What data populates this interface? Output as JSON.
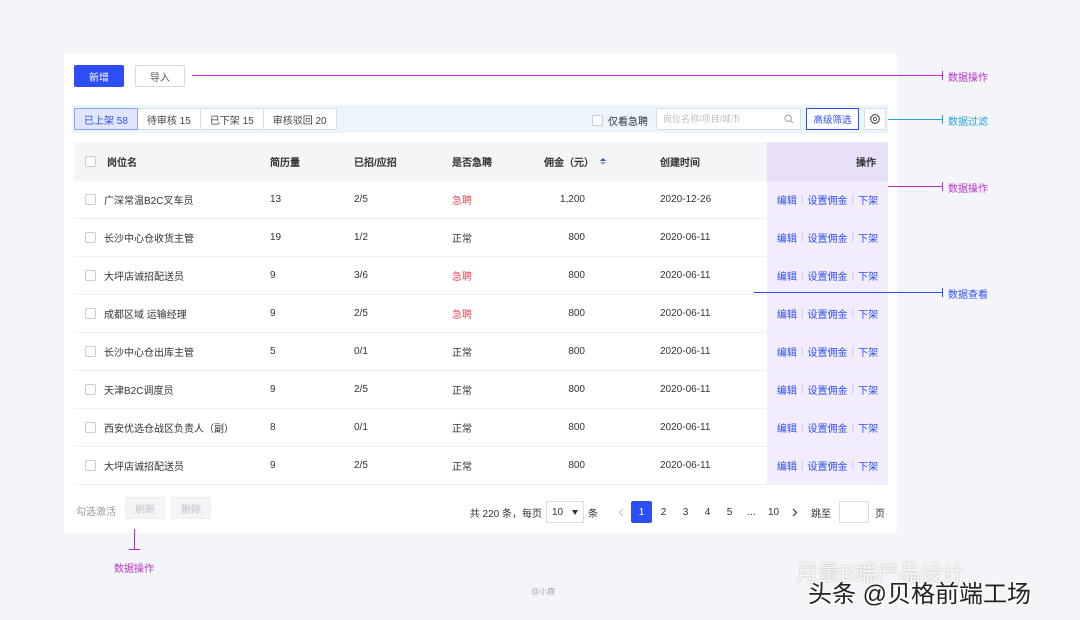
{
  "toolbar": {
    "add_label": "新增",
    "import_label": "导入"
  },
  "filter": {
    "tabs": [
      {
        "label": "已上架 58",
        "active": true
      },
      {
        "label": "待审核 15",
        "active": false
      },
      {
        "label": "已下架 15",
        "active": false
      },
      {
        "label": "审核驳回 20",
        "active": false
      }
    ],
    "urgent_only_label": "仅看急聘",
    "search_placeholder": "岗位名称/项目/城市",
    "advanced_label": "高级筛选",
    "settings_icon": "gear-icon"
  },
  "table": {
    "headers": {
      "name": "岗位名",
      "resume": "简历量",
      "hired": "已招/应招",
      "urgent": "是否急聘",
      "fee": "佣金（元）",
      "date": "创建时间",
      "ops": "操作"
    },
    "ops_labels": {
      "edit": "编辑",
      "set_fee": "设置佣金",
      "offline": "下架"
    },
    "rows": [
      {
        "name": "广深常温B2C叉车员",
        "resume": "13",
        "hired": "2/5",
        "urgent": "急聘",
        "is_urgent": true,
        "fee": "1,200",
        "date": "2020-12-26"
      },
      {
        "name": "长沙中心仓收货主管",
        "resume": "19",
        "hired": "1/2",
        "urgent": "正常",
        "is_urgent": false,
        "fee": "800",
        "date": "2020-06-11"
      },
      {
        "name": "大坪店诚招配送员",
        "resume": "9",
        "hired": "3/6",
        "urgent": "急聘",
        "is_urgent": true,
        "fee": "800",
        "date": "2020-06-11"
      },
      {
        "name": "成都区域 运输经理",
        "resume": "9",
        "hired": "2/5",
        "urgent": "急聘",
        "is_urgent": true,
        "fee": "800",
        "date": "2020-06-11"
      },
      {
        "name": "长沙中心仓出库主管",
        "resume": "5",
        "hired": "0/1",
        "urgent": "正常",
        "is_urgent": false,
        "fee": "800",
        "date": "2020-06-11"
      },
      {
        "name": "天津B2C调度员",
        "resume": "9",
        "hired": "2/5",
        "urgent": "正常",
        "is_urgent": false,
        "fee": "800",
        "date": "2020-06-11"
      },
      {
        "name": "西安优选仓战区负责人（副）",
        "resume": "8",
        "hired": "0/1",
        "urgent": "正常",
        "is_urgent": false,
        "fee": "800",
        "date": "2020-06-11"
      },
      {
        "name": "大坪店诚招配送员",
        "resume": "9",
        "hired": "2/5",
        "urgent": "正常",
        "is_urgent": false,
        "fee": "800",
        "date": "2020-06-11"
      }
    ]
  },
  "footer": {
    "select_hint": "勾选激活",
    "refresh_label": "刷新",
    "delete_label": "删除",
    "total_text": "共 220 条，每页",
    "page_size": "10",
    "per_unit": "条",
    "pages": [
      "1",
      "2",
      "3",
      "4",
      "5",
      "...",
      "10"
    ],
    "current_page": "1",
    "jump_label": "跳至",
    "page_unit": "页"
  },
  "annotations": {
    "top_ops": "数据操作",
    "filter": "数据过滤",
    "row_ops": "数据操作",
    "view": "数据查看",
    "bottom_ops": "数据操作"
  },
  "watermarks": {
    "small": "@小鹿",
    "line1": "月暈B端产品设计",
    "line2": "头条 @贝格前端工场"
  },
  "colors": {
    "primary": "#2d4ef5",
    "urgent": "#ee4f5f",
    "annotation_magenta": "#c02bcf",
    "annotation_blue": "#2d4ef5",
    "annotation_cyan": "#27a3e0",
    "ops_column_bg": "#f2ecfc"
  }
}
